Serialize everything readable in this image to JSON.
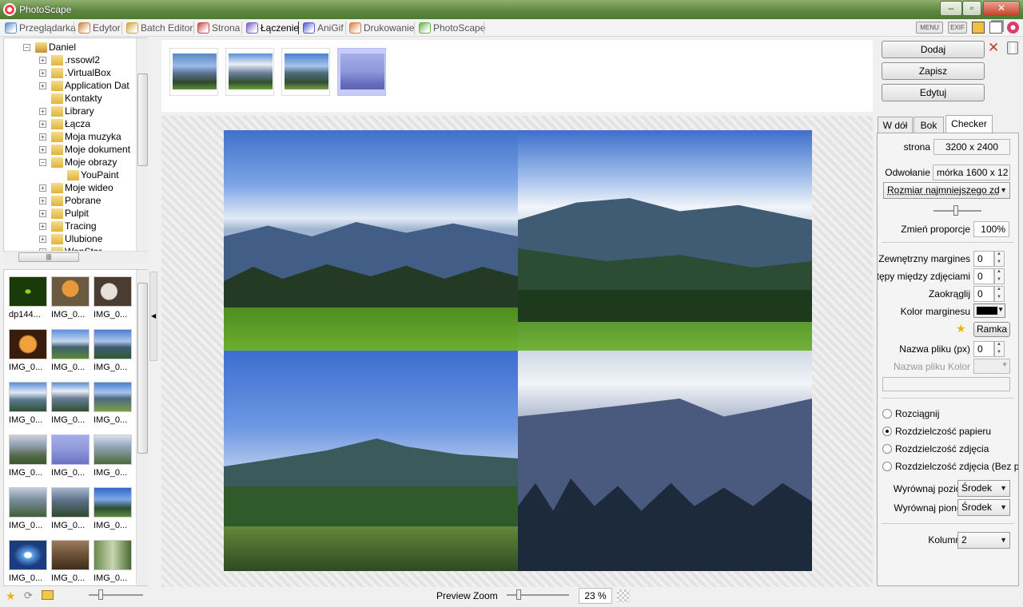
{
  "window": {
    "title": "PhotoScape"
  },
  "tabs": [
    {
      "label": "Przeglądarka",
      "color": "#5b8fc9"
    },
    {
      "label": "Edytor",
      "color": "#c9863d"
    },
    {
      "label": "Batch Editor",
      "color": "#d0a537"
    },
    {
      "label": "Strona",
      "color": "#c94a4a"
    },
    {
      "label": "Łączenie",
      "color": "#7a5bc9"
    },
    {
      "label": "AniGif",
      "color": "#4f5bd6"
    },
    {
      "label": "Drukowanie",
      "color": "#e07b39"
    },
    {
      "label": "PhotoScape",
      "color": "#68b14a"
    }
  ],
  "toolbar": {
    "menu_label": "MENU",
    "exif_label": "EXIF"
  },
  "tree": {
    "root": "Daniel",
    "items": [
      ".rssowl2",
      ".VirtualBox",
      "Application Dat",
      "Kontakty",
      "Library",
      "Łącza",
      "Moja muzyka",
      "Moje dokument",
      "Moje obrazy",
      "YouPaint",
      "Moje wideo",
      "Pobrane",
      "Pulpit",
      "Tracing",
      "Ulubione",
      "WenStar"
    ]
  },
  "files": [
    "dp144...",
    "IMG_0...",
    "IMG_0...",
    "IMG_0...",
    "IMG_0...",
    "IMG_0...",
    "IMG_0...",
    "IMG_0...",
    "IMG_0...",
    "IMG_0...",
    "IMG_0...",
    "IMG_0...",
    "IMG_0...",
    "IMG_0...",
    "IMG_0...",
    "IMG_0...",
    "IMG_0...",
    "IMG_0..."
  ],
  "buttons": {
    "add": "Dodaj",
    "save": "Zapisz",
    "edit": "Edytuj"
  },
  "right_tabs": [
    "W dół",
    "Bok",
    "Checker"
  ],
  "settings": {
    "page_label": "strona",
    "page_value": "3200 x 2400",
    "reference_label": "Odwołanie",
    "reference_value": "mórka 1600 x 12",
    "reference_mode": "Rozmiar najmniejszego zd",
    "aspect_label": "Zmień proporcje",
    "aspect_value": "100%",
    "outer_margin_label": "Zewnętrzny margines",
    "outer_margin_value": "0",
    "gap_label": "Odstępy między zdjęciami",
    "gap_value": "0",
    "round_label": "Zaokrąglij",
    "round_value": "0",
    "margin_color_label": "Kolor marginesu",
    "margin_color": "#000000",
    "frame_button": "Ramka",
    "filename_label": "Nazwa pliku (px)",
    "filename_value": "0",
    "filename_color_label": "Nazwa pliku Kolor",
    "radios": [
      "Rozciągnij",
      "Rozdzielczość papieru",
      "Rozdzielczość zdjęcia",
      "Rozdzielczość zdjęcia (Bez p"
    ],
    "radio_selected": 1,
    "halign_label": "Wyrównaj poziomo",
    "halign_value": "Środek",
    "valign_label": "Wyrównaj pionowo",
    "valign_value": "Środek",
    "columns_label": "Kolumny",
    "columns_value": "2"
  },
  "bottom": {
    "zoom_label": "Preview Zoom",
    "zoom_value": "23 %"
  }
}
